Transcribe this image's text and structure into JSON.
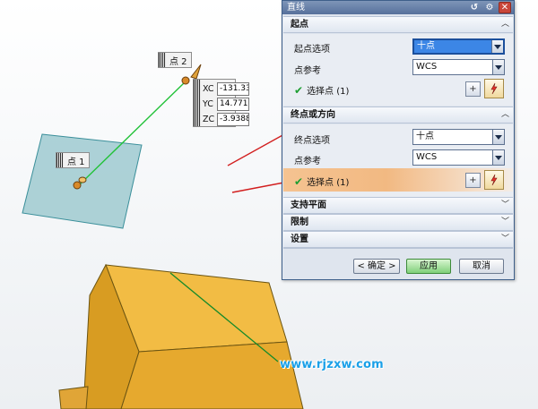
{
  "viewport": {
    "point1_label": "点 1",
    "point2_label": "点 2",
    "coords": [
      {
        "axis": "XC",
        "value": "-131.33"
      },
      {
        "axis": "YC",
        "value": "14.771"
      },
      {
        "axis": "ZC",
        "value": "-3.9388"
      }
    ],
    "watermark": "www.rjzxw.com",
    "colors": {
      "plane": "#9fcad0",
      "box": "#f0b63c",
      "line": "#23c23a",
      "arrow": "#d21e1e"
    }
  },
  "dialog": {
    "title": "直线",
    "start_section": {
      "title": "起点",
      "option_label": "起点选项",
      "option_value": "十点",
      "ref_label": "点参考",
      "ref_value": "WCS",
      "select_label": "选择点 (1)"
    },
    "end_section": {
      "title": "终点或方向",
      "option_label": "终点选项",
      "option_value": "十点",
      "ref_label": "点参考",
      "ref_value": "WCS",
      "select_label": "选择点 (1)"
    },
    "collapsed_sections": [
      "支持平面",
      "限制",
      "设置"
    ],
    "buttons": {
      "ok": "< 确定 >",
      "apply": "应用",
      "cancel": "取消"
    }
  }
}
